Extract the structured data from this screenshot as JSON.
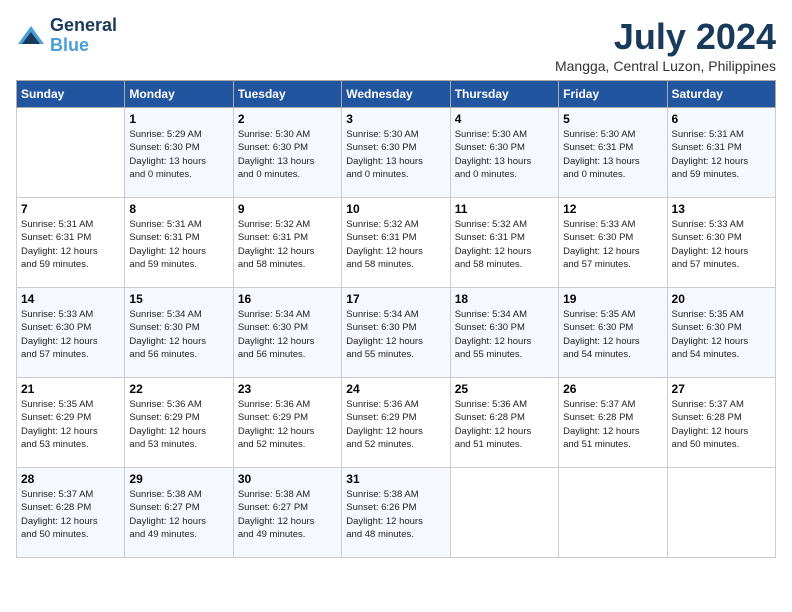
{
  "logo": {
    "line1": "General",
    "line2": "Blue"
  },
  "title": "July 2024",
  "location": "Mangga, Central Luzon, Philippines",
  "weekdays": [
    "Sunday",
    "Monday",
    "Tuesday",
    "Wednesday",
    "Thursday",
    "Friday",
    "Saturday"
  ],
  "weeks": [
    [
      {
        "day": "",
        "info": ""
      },
      {
        "day": "1",
        "info": "Sunrise: 5:29 AM\nSunset: 6:30 PM\nDaylight: 13 hours\nand 0 minutes."
      },
      {
        "day": "2",
        "info": "Sunrise: 5:30 AM\nSunset: 6:30 PM\nDaylight: 13 hours\nand 0 minutes."
      },
      {
        "day": "3",
        "info": "Sunrise: 5:30 AM\nSunset: 6:30 PM\nDaylight: 13 hours\nand 0 minutes."
      },
      {
        "day": "4",
        "info": "Sunrise: 5:30 AM\nSunset: 6:30 PM\nDaylight: 13 hours\nand 0 minutes."
      },
      {
        "day": "5",
        "info": "Sunrise: 5:30 AM\nSunset: 6:31 PM\nDaylight: 13 hours\nand 0 minutes."
      },
      {
        "day": "6",
        "info": "Sunrise: 5:31 AM\nSunset: 6:31 PM\nDaylight: 12 hours\nand 59 minutes."
      }
    ],
    [
      {
        "day": "7",
        "info": "Sunrise: 5:31 AM\nSunset: 6:31 PM\nDaylight: 12 hours\nand 59 minutes."
      },
      {
        "day": "8",
        "info": "Sunrise: 5:31 AM\nSunset: 6:31 PM\nDaylight: 12 hours\nand 59 minutes."
      },
      {
        "day": "9",
        "info": "Sunrise: 5:32 AM\nSunset: 6:31 PM\nDaylight: 12 hours\nand 58 minutes."
      },
      {
        "day": "10",
        "info": "Sunrise: 5:32 AM\nSunset: 6:31 PM\nDaylight: 12 hours\nand 58 minutes."
      },
      {
        "day": "11",
        "info": "Sunrise: 5:32 AM\nSunset: 6:31 PM\nDaylight: 12 hours\nand 58 minutes."
      },
      {
        "day": "12",
        "info": "Sunrise: 5:33 AM\nSunset: 6:30 PM\nDaylight: 12 hours\nand 57 minutes."
      },
      {
        "day": "13",
        "info": "Sunrise: 5:33 AM\nSunset: 6:30 PM\nDaylight: 12 hours\nand 57 minutes."
      }
    ],
    [
      {
        "day": "14",
        "info": "Sunrise: 5:33 AM\nSunset: 6:30 PM\nDaylight: 12 hours\nand 57 minutes."
      },
      {
        "day": "15",
        "info": "Sunrise: 5:34 AM\nSunset: 6:30 PM\nDaylight: 12 hours\nand 56 minutes."
      },
      {
        "day": "16",
        "info": "Sunrise: 5:34 AM\nSunset: 6:30 PM\nDaylight: 12 hours\nand 56 minutes."
      },
      {
        "day": "17",
        "info": "Sunrise: 5:34 AM\nSunset: 6:30 PM\nDaylight: 12 hours\nand 55 minutes."
      },
      {
        "day": "18",
        "info": "Sunrise: 5:34 AM\nSunset: 6:30 PM\nDaylight: 12 hours\nand 55 minutes."
      },
      {
        "day": "19",
        "info": "Sunrise: 5:35 AM\nSunset: 6:30 PM\nDaylight: 12 hours\nand 54 minutes."
      },
      {
        "day": "20",
        "info": "Sunrise: 5:35 AM\nSunset: 6:30 PM\nDaylight: 12 hours\nand 54 minutes."
      }
    ],
    [
      {
        "day": "21",
        "info": "Sunrise: 5:35 AM\nSunset: 6:29 PM\nDaylight: 12 hours\nand 53 minutes."
      },
      {
        "day": "22",
        "info": "Sunrise: 5:36 AM\nSunset: 6:29 PM\nDaylight: 12 hours\nand 53 minutes."
      },
      {
        "day": "23",
        "info": "Sunrise: 5:36 AM\nSunset: 6:29 PM\nDaylight: 12 hours\nand 52 minutes."
      },
      {
        "day": "24",
        "info": "Sunrise: 5:36 AM\nSunset: 6:29 PM\nDaylight: 12 hours\nand 52 minutes."
      },
      {
        "day": "25",
        "info": "Sunrise: 5:36 AM\nSunset: 6:28 PM\nDaylight: 12 hours\nand 51 minutes."
      },
      {
        "day": "26",
        "info": "Sunrise: 5:37 AM\nSunset: 6:28 PM\nDaylight: 12 hours\nand 51 minutes."
      },
      {
        "day": "27",
        "info": "Sunrise: 5:37 AM\nSunset: 6:28 PM\nDaylight: 12 hours\nand 50 minutes."
      }
    ],
    [
      {
        "day": "28",
        "info": "Sunrise: 5:37 AM\nSunset: 6:28 PM\nDaylight: 12 hours\nand 50 minutes."
      },
      {
        "day": "29",
        "info": "Sunrise: 5:38 AM\nSunset: 6:27 PM\nDaylight: 12 hours\nand 49 minutes."
      },
      {
        "day": "30",
        "info": "Sunrise: 5:38 AM\nSunset: 6:27 PM\nDaylight: 12 hours\nand 49 minutes."
      },
      {
        "day": "31",
        "info": "Sunrise: 5:38 AM\nSunset: 6:26 PM\nDaylight: 12 hours\nand 48 minutes."
      },
      {
        "day": "",
        "info": ""
      },
      {
        "day": "",
        "info": ""
      },
      {
        "day": "",
        "info": ""
      }
    ]
  ]
}
